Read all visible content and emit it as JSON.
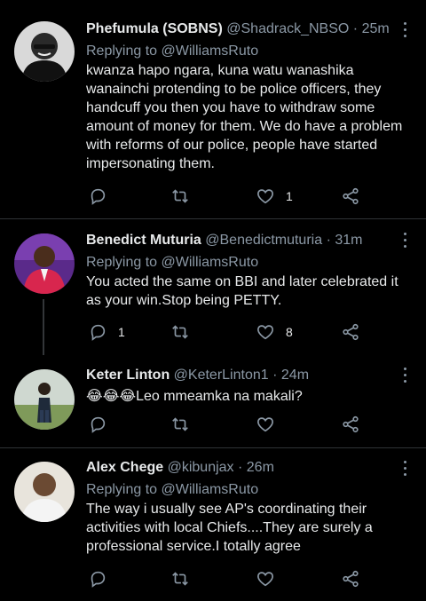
{
  "tweets": [
    {
      "name": "Phefumula (SOBNS)",
      "handle": "@Shadrack_NBSO",
      "time": "25m",
      "replying_prefix": "Replying to",
      "replying_to": "@WilliamsRuto",
      "text": "kwanza hapo ngara, kuna watu wanashika wanainchi protending to be police officers, they handcuff you then you have to withdraw some amount of money for them. We do have a problem with reforms of our police, people have started impersonating them.",
      "replies": "",
      "retweets": "",
      "likes": "1"
    },
    {
      "name": "Benedict Muturia",
      "handle": "@Benedictmuturia",
      "time": "31m",
      "replying_prefix": "Replying to",
      "replying_to": "@WilliamsRuto",
      "text": "You acted the same on BBI and later celebrated it as your win.Stop being PETTY.",
      "replies": "1",
      "retweets": "",
      "likes": "8"
    },
    {
      "name": "Keter Linton",
      "handle": "@KeterLinton1",
      "time": "24m",
      "text": "😂😂😂Leo mmeamka na makali?",
      "replies": "",
      "retweets": "",
      "likes": ""
    },
    {
      "name": "Alex Chege",
      "handle": "@kibunjax",
      "time": "26m",
      "replying_prefix": "Replying to",
      "replying_to": "@WilliamsRuto",
      "text": "The way i usually see AP's coordinating their activities with local Chiefs....They are surely a professional service.I totally  agree",
      "replies": "",
      "retweets": "",
      "likes": ""
    }
  ],
  "icons": {
    "reply": "reply-icon",
    "retweet": "retweet-icon",
    "like": "heart-icon",
    "share": "share-icon",
    "more": "more-options-icon"
  },
  "colors": {
    "background": "#000000",
    "primary_text": "#e7e9ea",
    "secondary_text": "#8b98a5",
    "divider": "#2f3336"
  }
}
